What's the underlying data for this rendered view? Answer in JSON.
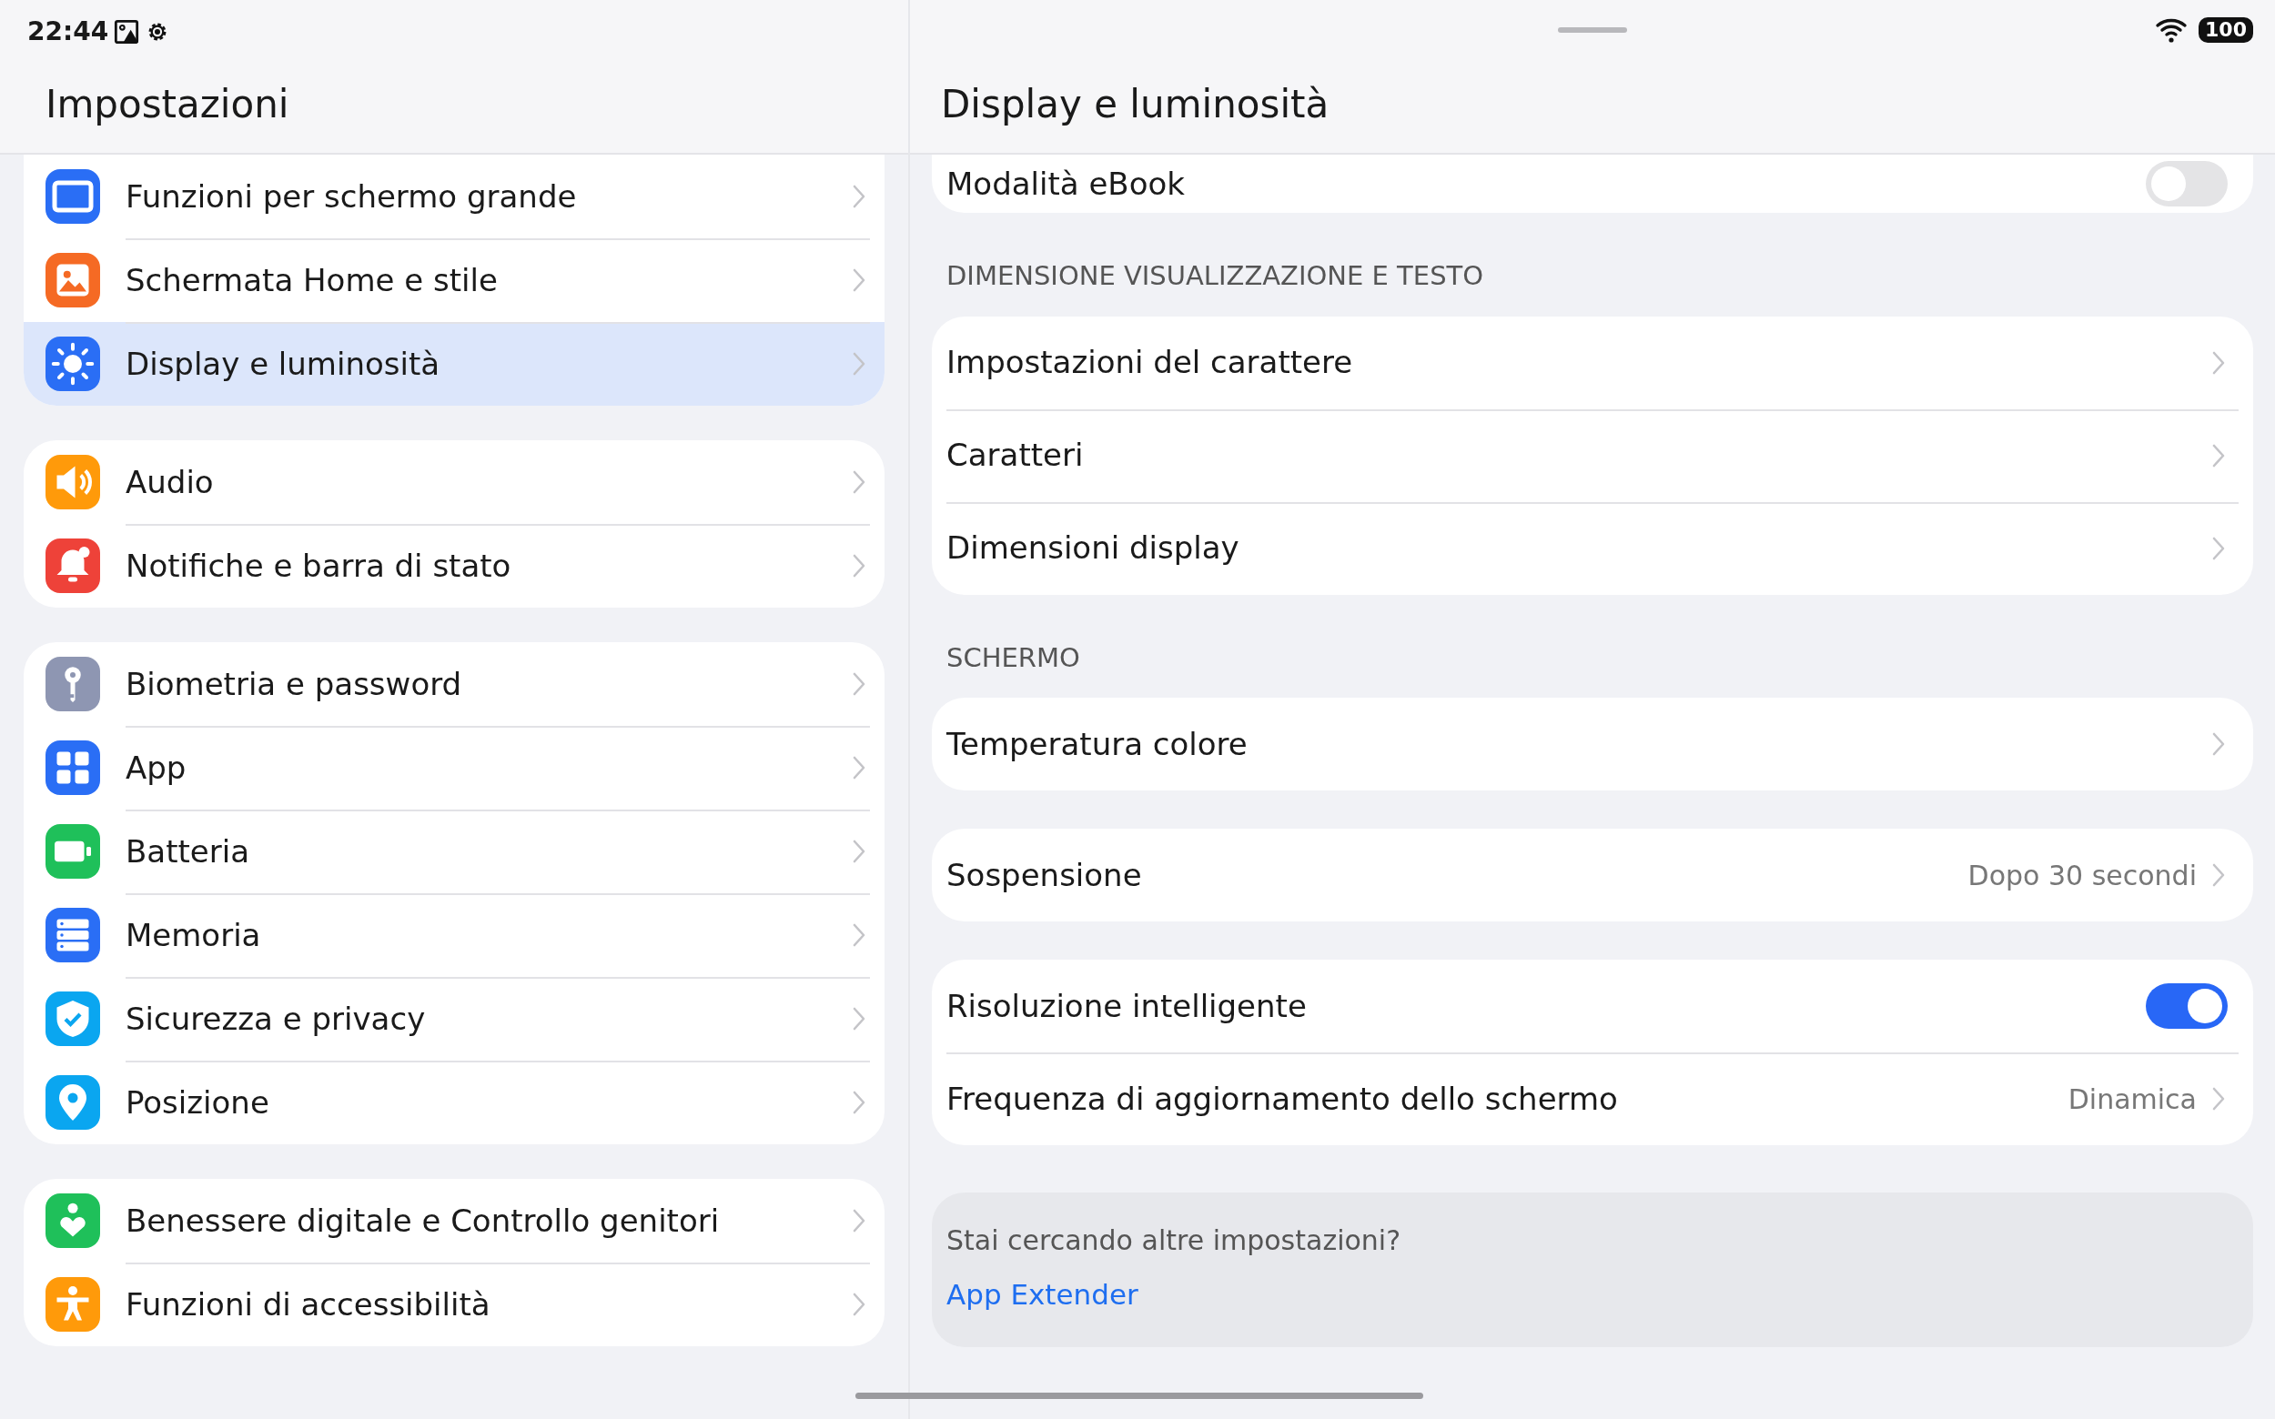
{
  "status_bar": {
    "time": "22:44",
    "battery": "100"
  },
  "left": {
    "title": "Impostazioni",
    "groups": [
      [
        {
          "label": "Funzioni per schermo grande",
          "color": "#2a6ef5",
          "selected": false
        },
        {
          "label": "Schermata Home e stile",
          "color": "#f56a24",
          "selected": false
        },
        {
          "label": "Display e luminosità",
          "color": "#2a6ef5",
          "selected": true
        }
      ],
      [
        {
          "label": "Audio",
          "color": "#ff9a0a",
          "selected": false
        },
        {
          "label": "Notifiche e barra di stato",
          "color": "#ee4239",
          "selected": false
        }
      ],
      [
        {
          "label": "Biometria e password",
          "color": "#8e96b2",
          "selected": false
        },
        {
          "label": "App",
          "color": "#2a6ef5",
          "selected": false
        },
        {
          "label": "Batteria",
          "color": "#1fc05a",
          "selected": false
        },
        {
          "label": "Memoria",
          "color": "#2a6ef5",
          "selected": false
        },
        {
          "label": "Sicurezza e privacy",
          "color": "#0aa6f0",
          "selected": false
        },
        {
          "label": "Posizione",
          "color": "#0aa6f0",
          "selected": false
        }
      ],
      [
        {
          "label": "Benessere digitale e Controllo genitori",
          "color": "#1fc05a",
          "selected": false
        },
        {
          "label": "Funzioni di accessibilità",
          "color": "#ff9a0a",
          "selected": false
        }
      ]
    ]
  },
  "right": {
    "title": "Display e luminosità",
    "sections": [
      {
        "rows": [
          {
            "label": "Modalità eBook",
            "kind": "toggle",
            "on": false
          }
        ]
      },
      {
        "header": "DIMENSIONE VISUALIZZAZIONE E TESTO",
        "rows": [
          {
            "label": "Impostazioni del carattere",
            "kind": "link"
          },
          {
            "label": "Caratteri",
            "kind": "link"
          },
          {
            "label": "Dimensioni display",
            "kind": "link"
          }
        ]
      },
      {
        "header": "SCHERMO",
        "rows": [
          {
            "label": "Temperatura colore",
            "kind": "link"
          }
        ]
      },
      {
        "rows": [
          {
            "label": "Sospensione",
            "kind": "link",
            "value": "Dopo 30 secondi"
          }
        ]
      },
      {
        "rows": [
          {
            "label": "Risoluzione intelligente",
            "kind": "toggle",
            "on": true
          },
          {
            "label": "Frequenza di aggiornamento dello schermo",
            "kind": "link",
            "value": "Dinamica"
          }
        ]
      }
    ],
    "footer": {
      "text": "Stai cercando altre impostazioni?",
      "link": "App Extender"
    }
  }
}
